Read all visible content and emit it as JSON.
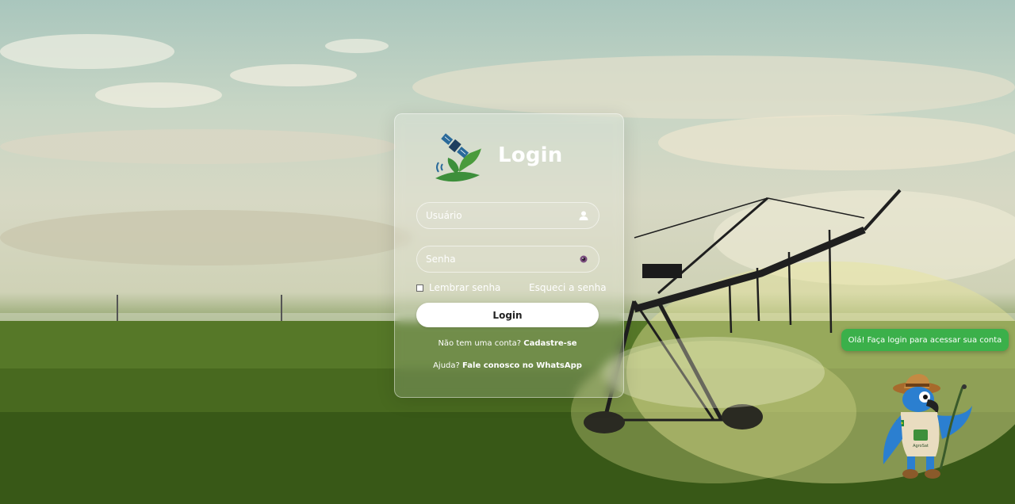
{
  "login": {
    "title": "Login",
    "username_placeholder": "Usuário",
    "password_placeholder": "Senha",
    "remember_label": "Lembrar senha",
    "forgot_label": "Esqueci a senha",
    "button_label": "Login",
    "signup_prefix": "Não tem uma conta?",
    "signup_link": "Cadastre-se",
    "help_prefix": "Ajuda?",
    "help_link": "Fale conosco no WhatsApp"
  },
  "chat": {
    "bubble_text": "Olá! Faça login para acessar sua conta"
  },
  "mascot": {
    "badge_text": "AgroSat"
  },
  "colors": {
    "chat_green": "#3bb04a",
    "button_bg": "#ffffff",
    "logo_green": "#3d8f3b",
    "logo_blue": "#2a6a9a"
  },
  "icons": {
    "username": "user-icon",
    "password": "eye-icon",
    "logo": "satellite-leaf-logo"
  }
}
